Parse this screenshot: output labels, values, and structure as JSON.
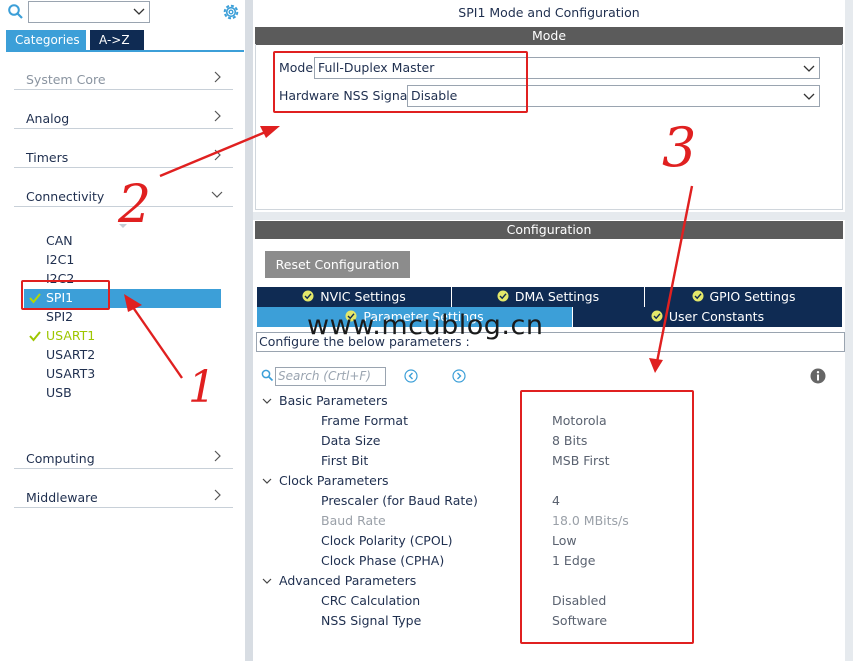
{
  "left": {
    "search": {
      "value": "",
      "placeholder": ""
    },
    "tabs": {
      "categories": "Categories",
      "az": "A->Z"
    },
    "categories": {
      "system_core": "System Core",
      "analog": "Analog",
      "timers": "Timers",
      "connectivity": "Connectivity",
      "computing": "Computing",
      "middleware": "Middleware"
    },
    "peripherals": {
      "can": "CAN",
      "i2c1": "I2C1",
      "i2c2": "I2C2",
      "spi1": "SPI1",
      "spi2": "SPI2",
      "usart1": "USART1",
      "usart2": "USART2",
      "usart3": "USART3",
      "usb": "USB"
    }
  },
  "main": {
    "title": "SPI1 Mode and Configuration",
    "mode_band": "Mode",
    "mode": {
      "label": "Mode",
      "value": "Full-Duplex Master"
    },
    "nss": {
      "label": "Hardware NSS Signal",
      "value": "Disable"
    },
    "config_band": "Configuration",
    "reset_button": "Reset Configuration",
    "tabs": {
      "nvic": "NVIC Settings",
      "dma": "DMA Settings",
      "gpio": "GPIO Settings",
      "params": "Parameter Settings",
      "user": "User Constants"
    },
    "configure_text": "Configure the below parameters :",
    "param_search_placeholder": "Search (Crtl+F)",
    "groups": {
      "basic": {
        "title": "Basic Parameters",
        "rows": [
          {
            "name": "Frame Format",
            "value": "Motorola"
          },
          {
            "name": "Data Size",
            "value": "8 Bits"
          },
          {
            "name": "First Bit",
            "value": "MSB First"
          }
        ]
      },
      "clock": {
        "title": "Clock Parameters",
        "rows": [
          {
            "name": "Prescaler (for Baud Rate)",
            "value": "4"
          },
          {
            "name": "Baud Rate",
            "value": "18.0 MBits/s"
          },
          {
            "name": "Clock Polarity (CPOL)",
            "value": "Low"
          },
          {
            "name": "Clock Phase (CPHA)",
            "value": "1 Edge"
          }
        ]
      },
      "advanced": {
        "title": "Advanced Parameters",
        "rows": [
          {
            "name": "CRC Calculation",
            "value": "Disabled"
          },
          {
            "name": "NSS Signal Type",
            "value": "Software"
          }
        ]
      }
    }
  },
  "annotations": {
    "watermark": "www.mcublog.cn",
    "step1": "1",
    "step2": "2",
    "step3": "3"
  },
  "colors": {
    "accent": "#3c9fd8",
    "navy": "#0f2b53",
    "band": "#5b5b5b",
    "annotation_red": "#e02020",
    "enabled_green": "#9ec600"
  },
  "icons": [
    "search-icon",
    "chevron-down-icon",
    "gear-icon",
    "chevron-right-icon",
    "check-icon",
    "info-icon",
    "arrow-left-icon",
    "arrow-right-icon"
  ]
}
